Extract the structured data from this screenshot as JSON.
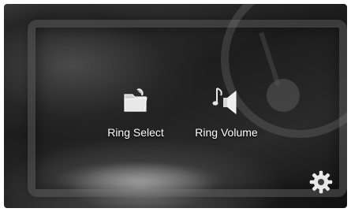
{
  "apps": [
    {
      "label": "Ring Select",
      "icon": "folder-icon"
    },
    {
      "label": "Ring Volume",
      "icon": "music-speaker-icon"
    }
  ],
  "settings": {
    "icon": "gear-icon"
  },
  "colors": {
    "label": "#ffffff",
    "icon": "#e6e6e6",
    "background": "#222222"
  }
}
